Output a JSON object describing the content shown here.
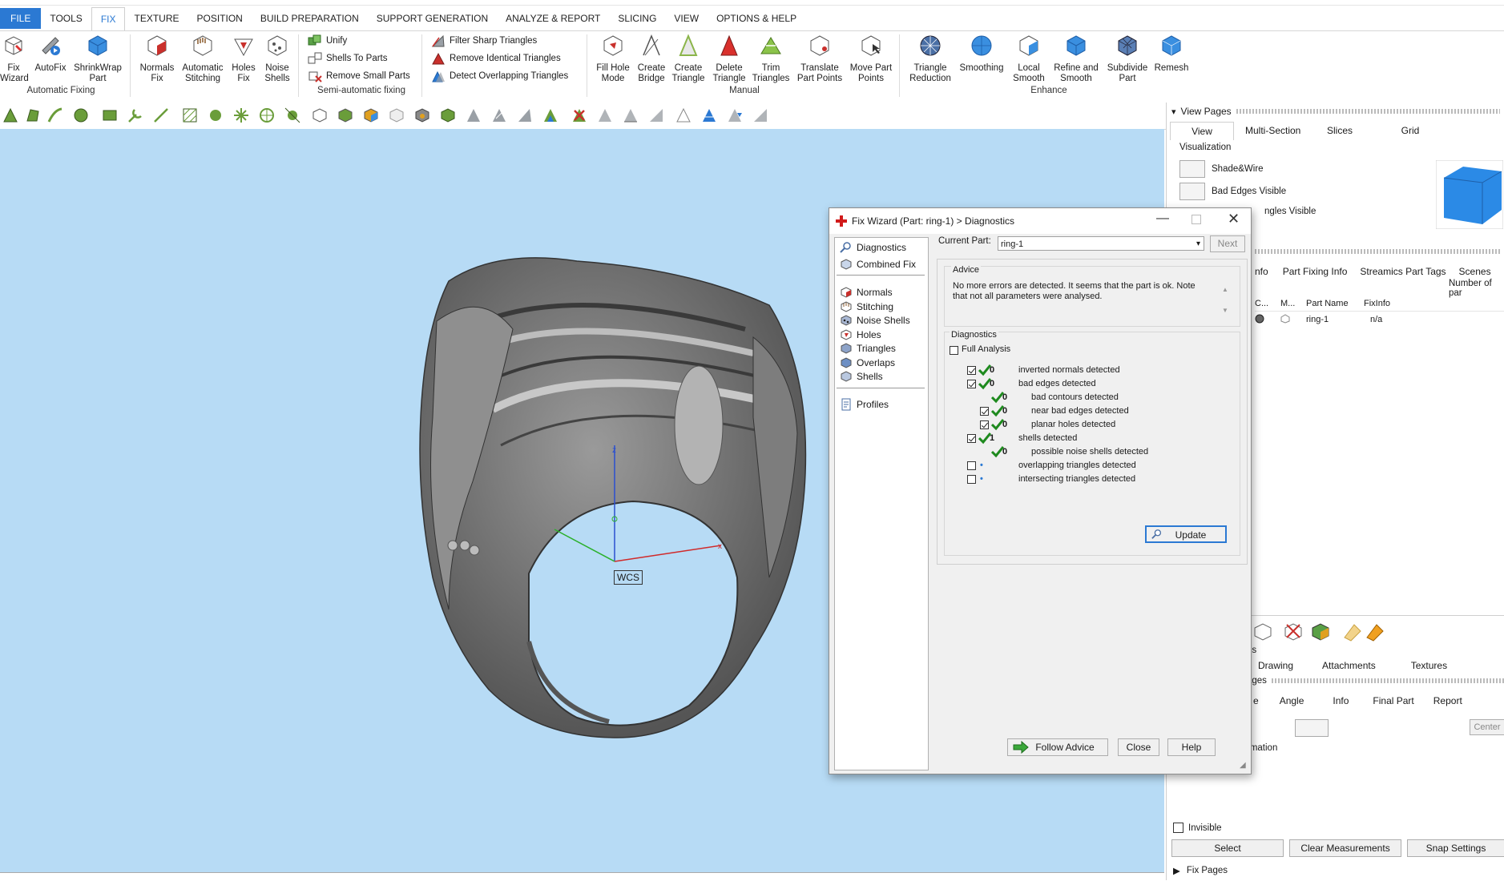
{
  "menu": {
    "items": [
      "FILE",
      "TOOLS",
      "FIX",
      "TEXTURE",
      "POSITION",
      "BUILD PREPARATION",
      "SUPPORT GENERATION",
      "ANALYZE & REPORT",
      "SLICING",
      "VIEW",
      "OPTIONS & HELP"
    ],
    "active": "FIX"
  },
  "ribbon": {
    "fix_wizard": "Fix\nWizard",
    "autofix": "AutoFix",
    "shrinkwrap": "ShrinkWrap\nPart",
    "normals_fix": "Normals\nFix",
    "auto_stitching": "Automatic\nStitching",
    "holes_fix": "Holes\nFix",
    "noise_shells": "Noise\nShells",
    "group_automatic": "Automatic Fixing",
    "unify": "Unify",
    "shells_to_parts": "Shells To Parts",
    "remove_small_parts": "Remove Small Parts",
    "group_semi": "Semi-automatic fixing",
    "filter_sharp": "Filter Sharp Triangles",
    "remove_identical": "Remove Identical Triangles",
    "detect_overlapping": "Detect Overlapping Triangles",
    "fill_hole_mode": "Fill Hole\nMode",
    "create_bridge": "Create\nBridge",
    "create_triangle": "Create\nTriangle",
    "delete_triangle": "Delete\nTriangle",
    "trim_triangles": "Trim\nTriangles",
    "translate_part_points": "Translate\nPart Points",
    "move_part_points": "Move Part\nPoints",
    "group_manual": "Manual",
    "triangle_reduction": "Triangle\nReduction",
    "smoothing": "Smoothing",
    "local_smooth": "Local\nSmooth",
    "refine_smooth": "Refine and\nSmooth",
    "subdivide_part": "Subdivide\nPart",
    "remesh": "Remesh",
    "group_enhance": "Enhance"
  },
  "viewport": {
    "wcs_label": "WCS",
    "bg": "#b7dbf5"
  },
  "right_panel": {
    "view_pages_title": "View Pages",
    "view_tabs": [
      "View",
      "Multi-Section",
      "Slices",
      "Grid"
    ],
    "visualization_label": "Visualization",
    "shade_wire": "Shade&Wire",
    "bad_edges_visible": "Bad Edges Visible",
    "triangles_visible": "ngles Visible",
    "info_tabs": [
      "nfo",
      "Part Fixing Info",
      "Streamics Part Tags",
      "Scenes"
    ],
    "number_of_parts": "Number of par",
    "table_headers": [
      "C...",
      "M...",
      "Part Name",
      "FixInfo"
    ],
    "table_row": {
      "name": "ring-1",
      "fixinfo": "n/a"
    },
    "lower_tabs": [
      "Drawing",
      "Attachments",
      "Textures"
    ],
    "lower_tabs_prefix": "es",
    "pages_label": "ages",
    "measure_tabs": [
      "e",
      "Angle",
      "Info",
      "Final Part",
      "Report"
    ],
    "center_label": "Center",
    "rmation_label": "rmation",
    "invisible_label": "Invisible",
    "select_button": "Select",
    "clear_measurements": "Clear Measurements",
    "snap_settings": "Snap Settings",
    "fix_pages": "Fix Pages"
  },
  "dialog": {
    "title": "Fix Wizard (Part: ring-1) > Diagnostics",
    "nav": [
      "Diagnostics",
      "Combined Fix",
      "Normals",
      "Stitching",
      "Noise Shells",
      "Holes",
      "Triangles",
      "Overlaps",
      "Shells",
      "Profiles"
    ],
    "current_part_label": "Current Part:",
    "current_part_value": "ring-1",
    "next_button": "Next",
    "advice_label": "Advice",
    "advice_text": "No more errors are detected. It seems that the part is ok. Note that not all parameters were analysed.",
    "diagnostics_label": "Diagnostics",
    "full_analysis": "Full Analysis",
    "rows": [
      {
        "label": "inverted normals detected",
        "value": "0"
      },
      {
        "label": "bad edges detected",
        "value": "0"
      },
      {
        "label": "bad contours detected",
        "value": "0"
      },
      {
        "label": "near bad edges detected",
        "value": "0"
      },
      {
        "label": "planar holes detected",
        "value": "0"
      },
      {
        "label": "shells detected",
        "value": "1"
      },
      {
        "label": "possible noise shells detected",
        "value": "0"
      },
      {
        "label": "overlapping triangles detected",
        "value": "•"
      },
      {
        "label": "intersecting triangles detected",
        "value": "•"
      }
    ],
    "update_button": "Update",
    "follow_advice": "Follow Advice",
    "close_button": "Close",
    "help_button": "Help"
  }
}
